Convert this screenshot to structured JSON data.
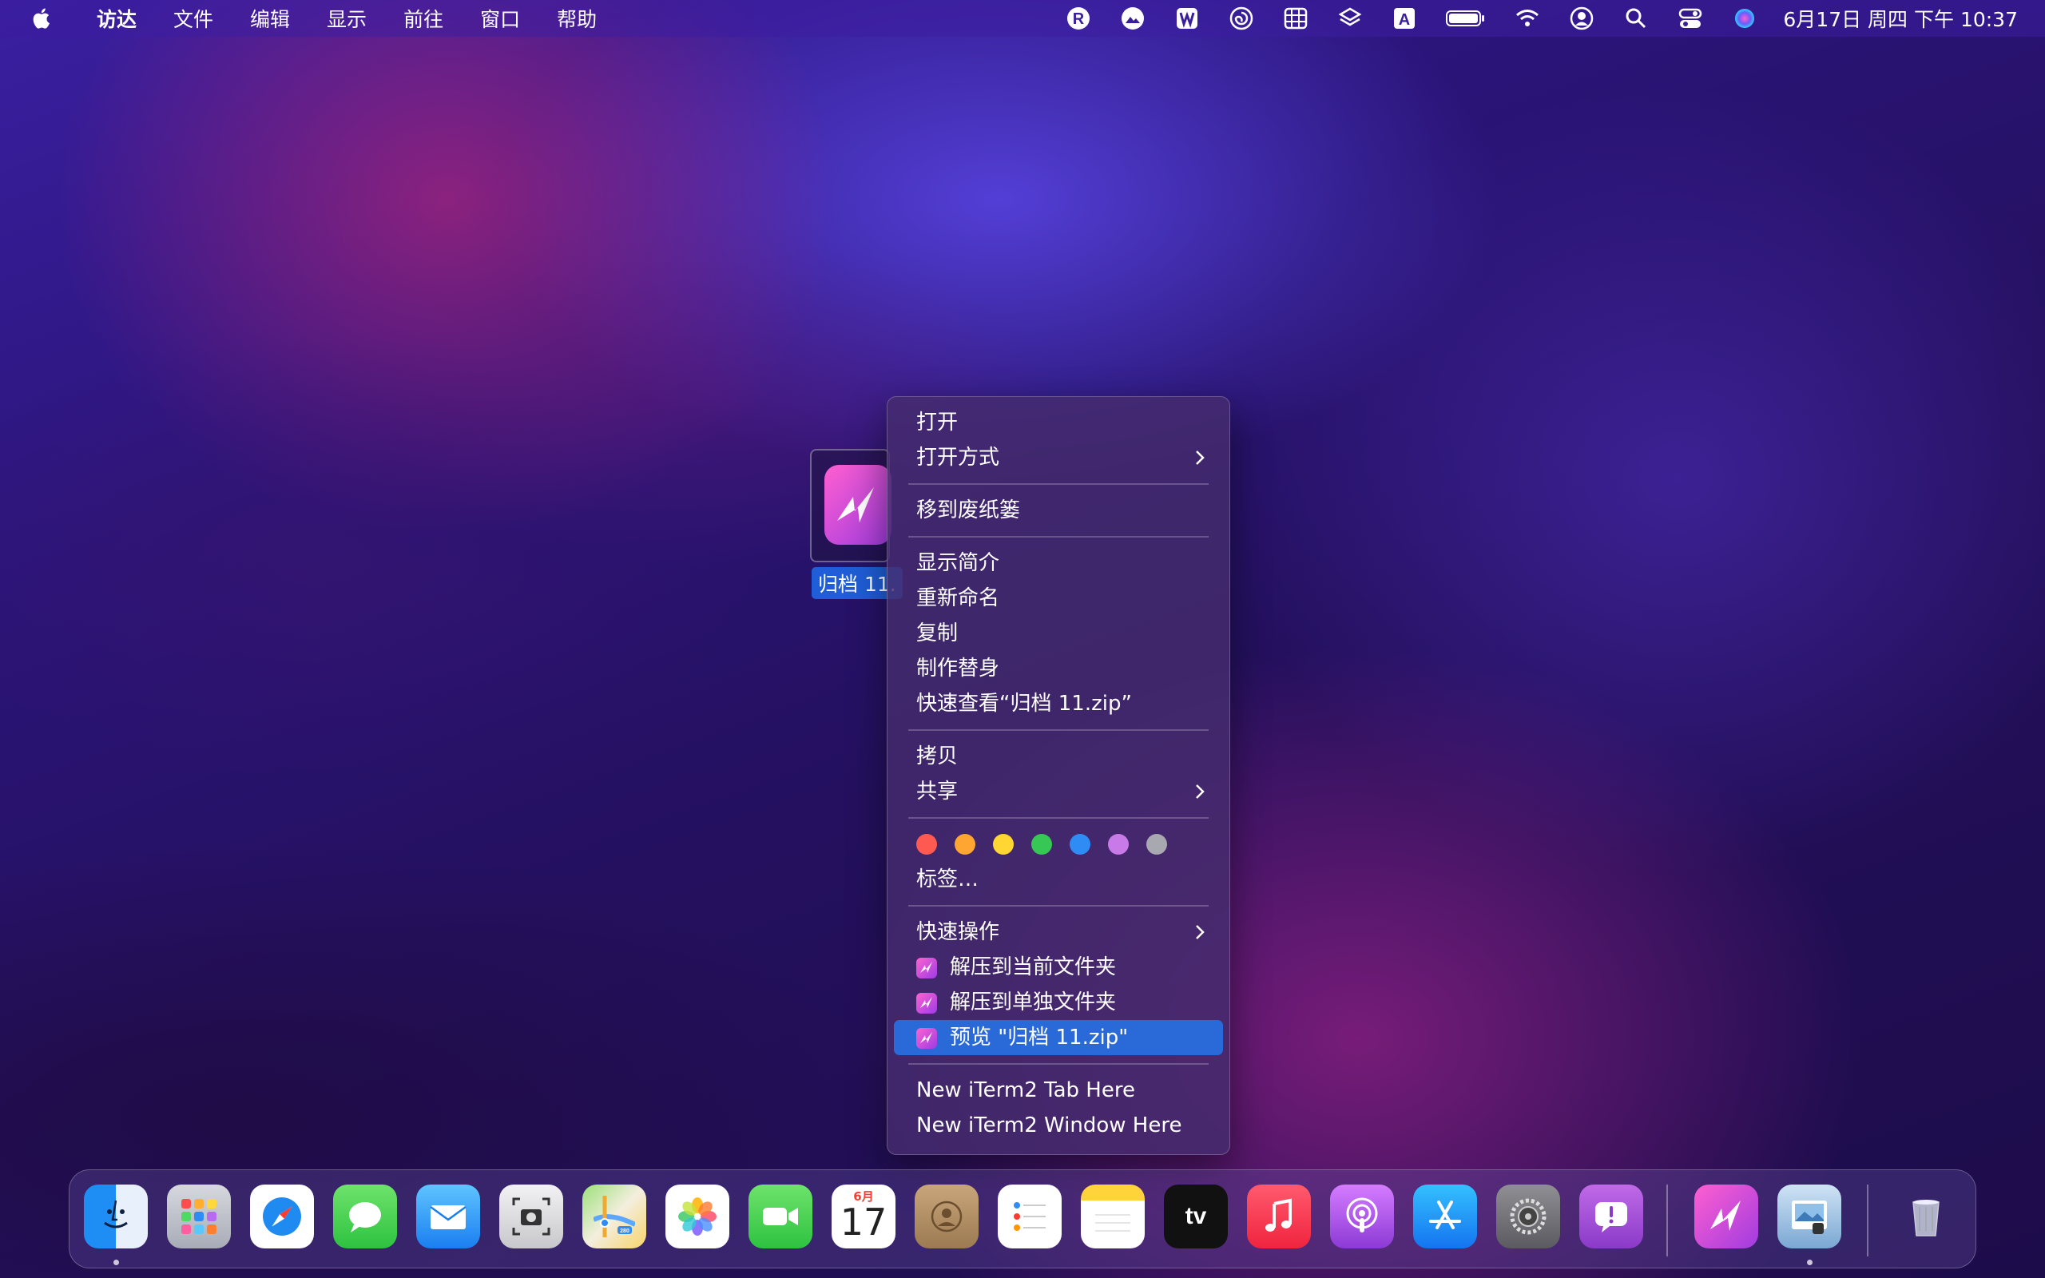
{
  "menubar": {
    "app_name": "访达",
    "items": [
      "文件",
      "编辑",
      "显示",
      "前往",
      "窗口",
      "帮助"
    ],
    "status_icons": [
      "r-badge-icon",
      "photo-cloud-icon",
      "w-badge-icon",
      "spiral-icon",
      "grid-icon",
      "layers-icon",
      "input-source-a-icon",
      "battery-icon",
      "wifi-icon",
      "user-icon",
      "search-icon",
      "control-center-icon",
      "siri-icon"
    ],
    "input_source_letter": "A",
    "r_badge_letter": "R",
    "clock": "6月17日 周四 下午 10:37"
  },
  "desktop_file": {
    "label": "归档 11."
  },
  "context_menu": {
    "open": "打开",
    "open_with": "打开方式",
    "move_to_trash": "移到废纸篓",
    "get_info": "显示简介",
    "rename": "重新命名",
    "duplicate": "复制",
    "make_alias": "制作替身",
    "quick_look": "快速查看“归档 11.zip”",
    "copy": "拷贝",
    "share": "共享",
    "tag_colors": [
      "#ff5a52",
      "#ffa632",
      "#ffd632",
      "#36c755",
      "#2f8cf5",
      "#c87ae8",
      "#a8a8b0"
    ],
    "tags": "标签…",
    "quick_actions": "快速操作",
    "extract_here": "解压到当前文件夹",
    "extract_separate": "解压到单独文件夹",
    "preview": "预览 \"归档 11.zip\"",
    "iterm_tab": "New iTerm2 Tab Here",
    "iterm_window": "New iTerm2 Window Here",
    "highlight_color": "#2a6ad8"
  },
  "dock": {
    "apps": [
      "Finder",
      "Launchpad",
      "Safari",
      "Messages",
      "Mail",
      "Screenshot",
      "Maps",
      "Photos",
      "FaceTime",
      "Calendar",
      "Contacts",
      "Reminders",
      "Notes",
      "Apple TV",
      "Music",
      "Podcasts",
      "App Store",
      "System Preferences",
      "Feedback Assistant",
      "Archiver",
      "Preview",
      "Trash"
    ],
    "calendar_month": "6月",
    "calendar_day": "17",
    "tv_label": "tv",
    "maps_badge": "280"
  }
}
